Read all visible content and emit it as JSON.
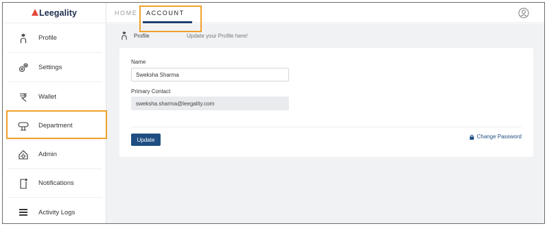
{
  "brand": {
    "name": "Leegality",
    "logo_color": "#e5453b"
  },
  "sidebar": {
    "items": [
      {
        "label": "Profile",
        "icon": "person-icon"
      },
      {
        "label": "Settings",
        "icon": "gears-icon"
      },
      {
        "label": "Wallet",
        "icon": "rupee-icon"
      },
      {
        "label": "Department",
        "icon": "department-icon"
      },
      {
        "label": "Admin",
        "icon": "admin-house-icon"
      },
      {
        "label": "Notifications",
        "icon": "notification-bell-icon"
      },
      {
        "label": "Activity Logs",
        "icon": "activity-logs-icon"
      }
    ]
  },
  "topbar": {
    "tabs": [
      {
        "label": "HOME",
        "active": false
      },
      {
        "label": "ACCOUNT",
        "active": true
      }
    ],
    "user_icon": "user-circle-icon"
  },
  "profile": {
    "title": "Profile",
    "hint": "Update your Profile here!",
    "name_label": "Name",
    "name_value": "Sweksha Sharma",
    "contact_label": "Primary Contact",
    "contact_value": "sweksha.sharma@leegality.com",
    "update_label": "Update",
    "change_password_label": "Change Password"
  },
  "colors": {
    "accent": "#1e4e82",
    "highlight": "#f0a029",
    "content_bg": "#f1f2f4"
  }
}
